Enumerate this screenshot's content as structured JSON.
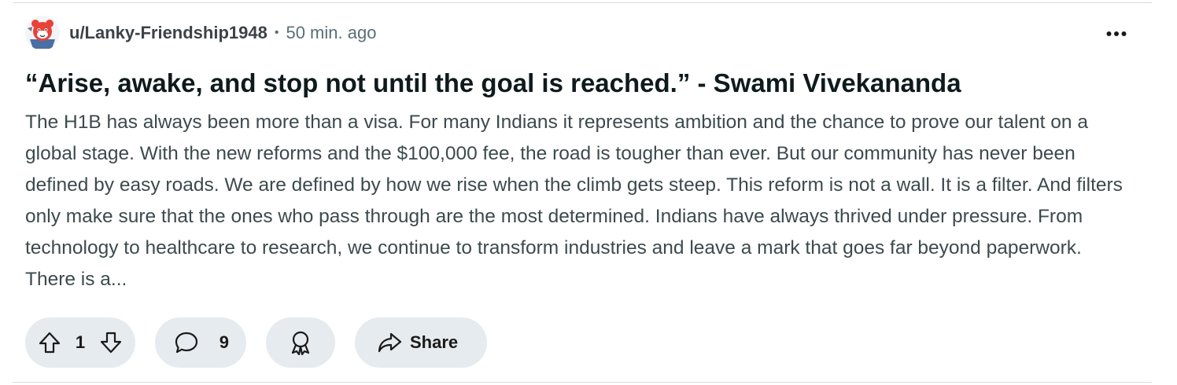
{
  "post": {
    "author": "u/Lanky-Friendship1948",
    "separator": "•",
    "time": "50 min. ago",
    "title": "“Arise, awake, and stop not until the goal is reached.” - Swami Vivekananda",
    "body": "The H1B has always been more than a visa. For many Indians it represents ambition and the chance to prove our talent on a global stage. With the new reforms and the $100,000 fee, the road is tougher than ever. But our community has never been defined by easy roads. We are defined by how we rise when the climb gets steep. This reform is not a wall. It is a filter. And filters only make sure that the ones who pass through are the most determined. Indians have always thrived under pressure. From technology to healthcare to research, we continue to transform industries and leave a mark that goes far beyond paperwork. There is a..."
  },
  "actions": {
    "vote_count": "1",
    "comment_count": "9",
    "share_label": "Share"
  },
  "icons": {
    "more": "more-horizontal-icon",
    "upvote": "upvote-arrow-icon",
    "downvote": "downvote-arrow-icon",
    "comment": "comment-bubble-icon",
    "award": "award-ribbon-icon",
    "share": "share-arrow-icon"
  },
  "colors": {
    "pill_bg": "#e5ebee",
    "meta_text": "#576f76",
    "title_text": "#0f1a1c",
    "body_text": "#3d4a4d",
    "avatar_accent": "#e8423b"
  }
}
